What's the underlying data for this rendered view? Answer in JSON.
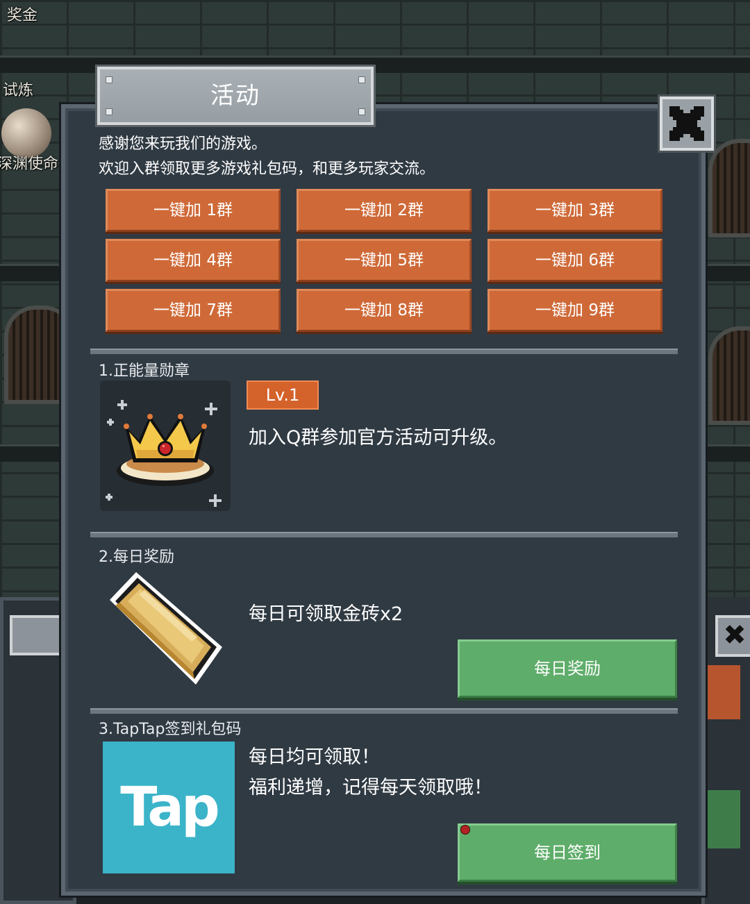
{
  "background": {
    "side_labels": [
      "奖金",
      "试炼",
      "深渊使命"
    ]
  },
  "modal": {
    "title": "活动",
    "close_icon": "close-x-icon",
    "intro_lines": [
      "感谢您来玩我们的游戏。",
      "欢迎入群领取更多游戏礼包码，和更多玩家交流。"
    ],
    "group_buttons": [
      "一键加 1群",
      "一键加 2群",
      "一键加 3群",
      "一键加 4群",
      "一键加 5群",
      "一键加 6群",
      "一键加 7群",
      "一键加 8群",
      "一键加 9群"
    ],
    "sections": [
      {
        "label": "1.正能量勋章",
        "icon": "crown-medal-icon",
        "level": "Lv.1",
        "description": "加入Q群参加官方活动可升级。"
      },
      {
        "label": "2.每日奖励",
        "icon": "gold-brick-icon",
        "description": "每日可领取金砖x2",
        "button": "每日奖励"
      },
      {
        "label": "3.TapTap签到礼包码",
        "icon": "taptap-logo",
        "logo_text": "Tap",
        "description_lines": [
          "每日均可领取！",
          "福利递增，记得每天领取哦！"
        ],
        "button": "每日签到",
        "has_notification_dot": true
      }
    ]
  },
  "colors": {
    "panel": "#303a43",
    "orange_button": "#cf6a38",
    "green_button": "#5fad6a",
    "taptap_brand": "#3bb4c9",
    "level_badge": "#d4622b"
  }
}
